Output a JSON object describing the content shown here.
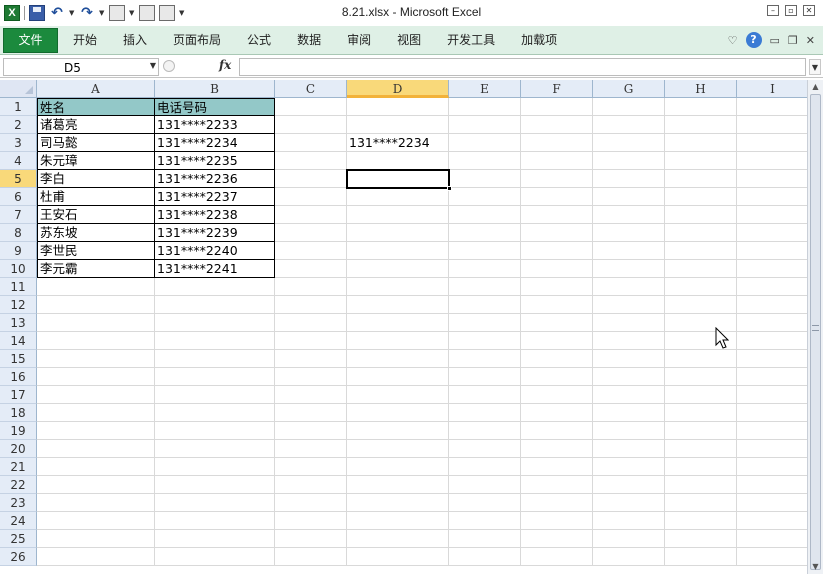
{
  "window": {
    "title": "8.21.xlsx  -  Microsoft Excel"
  },
  "qat": {
    "app_logo": "X"
  },
  "ribbon": {
    "file_tab": "文件",
    "tabs": [
      "开始",
      "插入",
      "页面布局",
      "公式",
      "数据",
      "审阅",
      "视图",
      "开发工具",
      "加载项"
    ],
    "help": "?"
  },
  "formula_bar": {
    "name_box": "D5",
    "fx": "fx",
    "formula": ""
  },
  "grid": {
    "columns": [
      "A",
      "B",
      "C",
      "D",
      "E",
      "F",
      "G",
      "H",
      "I"
    ],
    "rows": [
      "1",
      "2",
      "3",
      "4",
      "5",
      "6",
      "7",
      "8",
      "9",
      "10",
      "11",
      "12",
      "13",
      "14",
      "15",
      "16",
      "17",
      "18",
      "19",
      "20",
      "21",
      "22",
      "23",
      "24",
      "25",
      "26"
    ],
    "selected_column": "D",
    "selected_row": "5",
    "table": {
      "header": [
        "姓名",
        "电话号码"
      ],
      "rows": [
        [
          "诸葛亮",
          "131****2233"
        ],
        [
          "司马懿",
          "131****2234"
        ],
        [
          "朱元璋",
          "131****2235"
        ],
        [
          "李白",
          "131****2236"
        ],
        [
          "杜甫",
          "131****2237"
        ],
        [
          "王安石",
          "131****2238"
        ],
        [
          "苏东坡",
          "131****2239"
        ],
        [
          "李世民",
          "131****2240"
        ],
        [
          "李元霸",
          "131****2241"
        ]
      ]
    },
    "d3_value": "131****2234"
  },
  "colors": {
    "header_fill": "#93c8c8",
    "file_tab": "#1b8a3d",
    "ribbon_bg": "#dff0e6",
    "selected_header": "#f9d97a"
  }
}
